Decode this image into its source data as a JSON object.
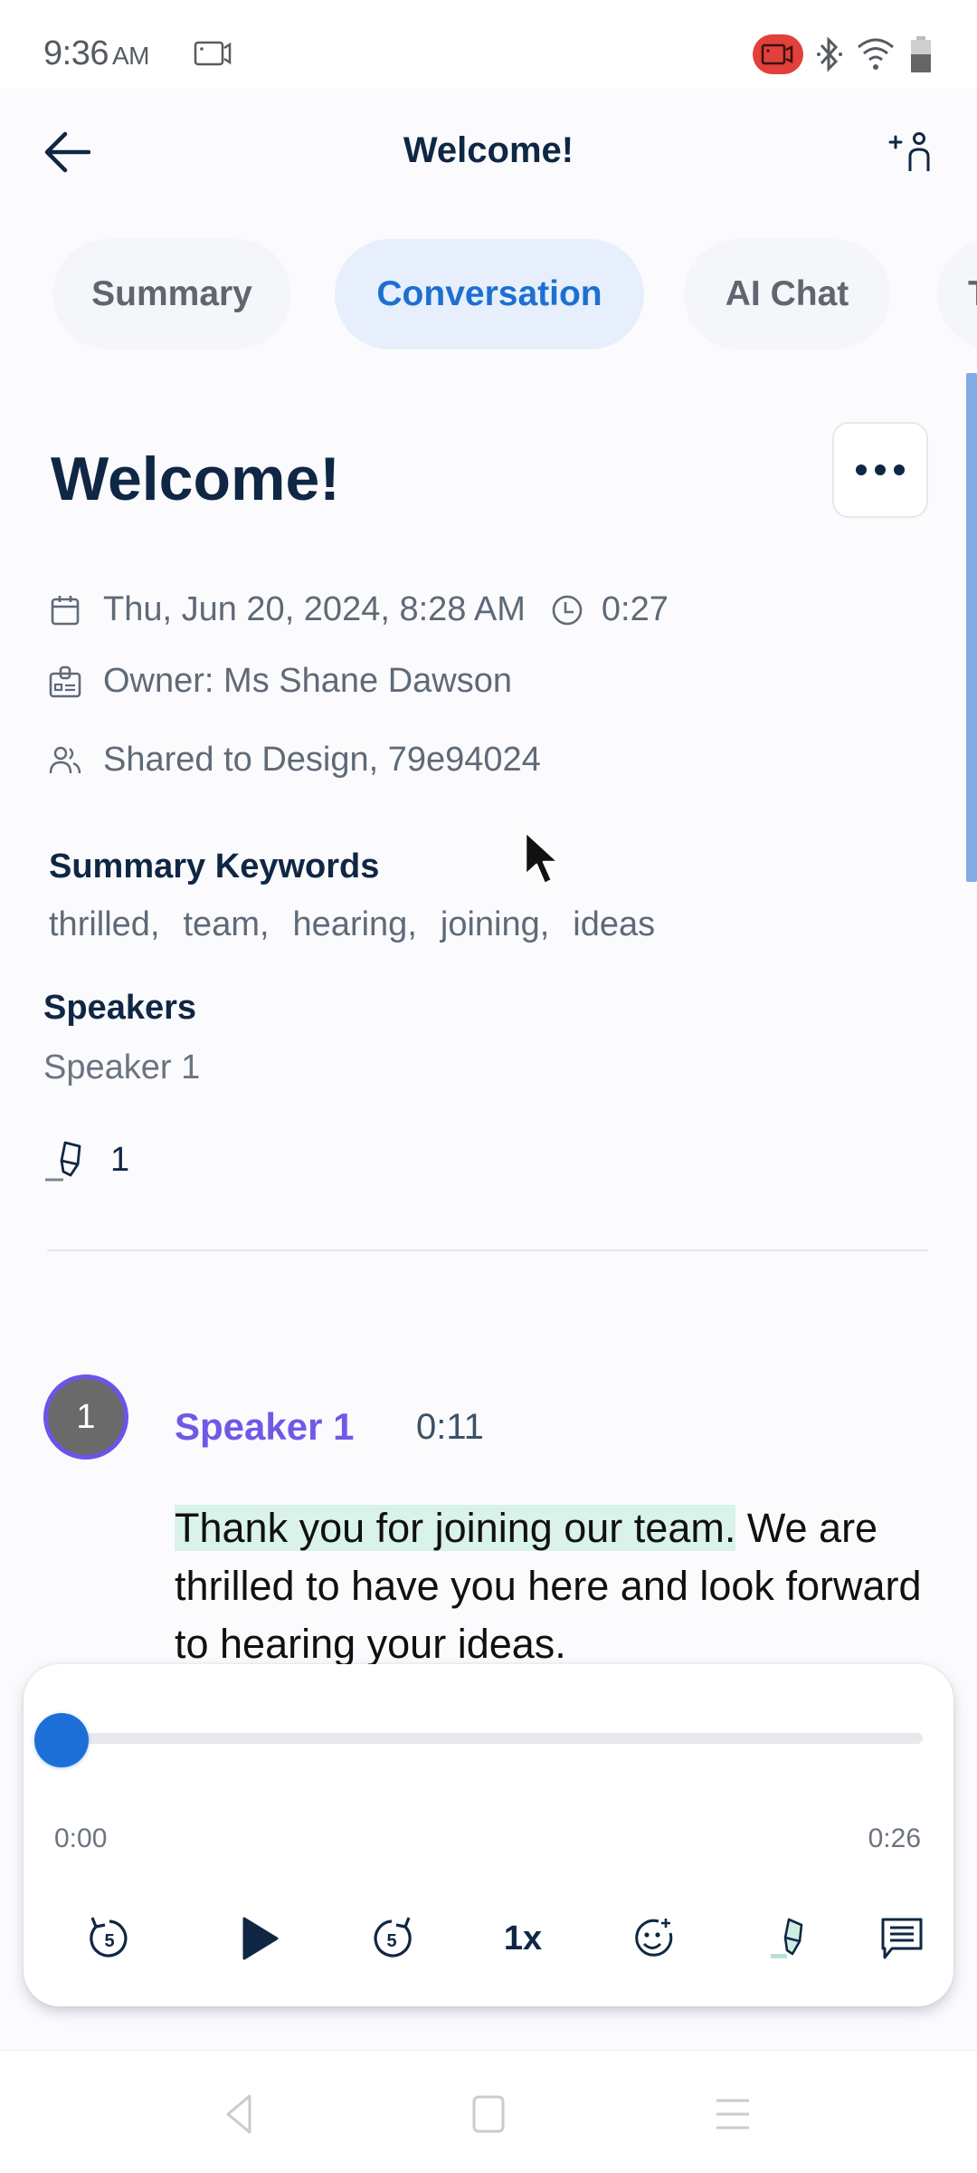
{
  "status_bar": {
    "time": "9:36",
    "ampm": "AM",
    "icons": [
      "screen-record-icon",
      "recording-badge-icon",
      "bluetooth-icon",
      "wifi-icon",
      "battery-icon"
    ]
  },
  "app_bar": {
    "title": "Welcome!",
    "back_icon": "arrow-left-icon",
    "add_person_icon": "add-person-icon"
  },
  "tabs": [
    {
      "label": "Summary",
      "active": false
    },
    {
      "label": "Conversation",
      "active": true
    },
    {
      "label": "AI Chat",
      "active": false
    },
    {
      "label": "T",
      "active": false
    }
  ],
  "note": {
    "title": "Welcome!",
    "date": "Thu, Jun 20, 2024, 8:28 AM",
    "duration": "0:27",
    "owner": "Owner: Ms Shane Dawson",
    "shared": "Shared to Design, 79e94024"
  },
  "keywords": {
    "heading": "Summary Keywords",
    "items": [
      "thrilled,",
      "team,",
      "hearing,",
      "joining,",
      "ideas"
    ]
  },
  "speakers": {
    "heading": "Speakers",
    "items": [
      "Speaker 1"
    ]
  },
  "highlights": {
    "count": "1"
  },
  "transcript": {
    "avatar_label": "1",
    "speaker": "Speaker 1",
    "timestamp": "0:11",
    "highlighted_text": "Thank you for joining our team.",
    "rest_text": " We are thrilled to have you here and look forward to hearing your ideas."
  },
  "player": {
    "current_time": "0:00",
    "total_time": "0:26",
    "progress_fraction": 0.0,
    "speed_label": "1x",
    "controls": [
      "rewind-5-icon",
      "play-icon",
      "forward-5-icon",
      "speed-button",
      "add-reaction-icon",
      "highlighter-icon",
      "comment-icon"
    ]
  },
  "colors": {
    "accent": "#1e6fd0",
    "speaker": "#7058e8",
    "highlight": "#d9f2ea",
    "recording": "#e2403a"
  }
}
